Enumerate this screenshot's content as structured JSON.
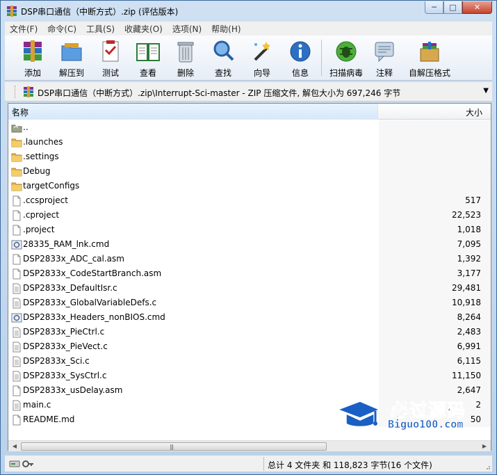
{
  "window": {
    "title": "DSP串口通信（中断方式）.zip (评估版本)",
    "controls": {
      "minimize": "─",
      "maximize": "□",
      "close": "✕"
    }
  },
  "menu": [
    "文件(F)",
    "命令(C)",
    "工具(S)",
    "收藏夹(O)",
    "选项(N)",
    "帮助(H)"
  ],
  "toolbar": [
    {
      "label": "添加",
      "icon": "add-archive-icon"
    },
    {
      "label": "解压到",
      "icon": "extract-to-icon"
    },
    {
      "label": "测试",
      "icon": "test-icon"
    },
    {
      "label": "查看",
      "icon": "view-book-icon"
    },
    {
      "label": "删除",
      "icon": "delete-trash-icon"
    },
    {
      "label": "查找",
      "icon": "find-magnifier-icon"
    },
    {
      "label": "向导",
      "icon": "wizard-wand-icon"
    },
    {
      "label": "信息",
      "icon": "info-icon"
    },
    {
      "label": "扫描病毒",
      "icon": "virus-scan-icon"
    },
    {
      "label": "注释",
      "icon": "comment-icon"
    },
    {
      "label": "自解压格式",
      "icon": "sfx-box-icon"
    }
  ],
  "address": {
    "path": "DSP串口通信（中断方式）.zip\\Interrupt-Sci-master - ZIP 压缩文件, 解包大小为 697,246 字节"
  },
  "columns": {
    "name": "名称",
    "size": "大小"
  },
  "files": [
    {
      "name": "..",
      "size": "",
      "type": "parent"
    },
    {
      "name": ".launches",
      "size": "",
      "type": "folder"
    },
    {
      "name": ".settings",
      "size": "",
      "type": "folder"
    },
    {
      "name": "Debug",
      "size": "",
      "type": "folder"
    },
    {
      "name": "targetConfigs",
      "size": "",
      "type": "folder"
    },
    {
      "name": ".ccsproject",
      "size": "517",
      "type": "file"
    },
    {
      "name": ".cproject",
      "size": "22,523",
      "type": "file"
    },
    {
      "name": ".project",
      "size": "1,018",
      "type": "file"
    },
    {
      "name": "28335_RAM_lnk.cmd",
      "size": "7,095",
      "type": "cmd"
    },
    {
      "name": "DSP2833x_ADC_cal.asm",
      "size": "1,392",
      "type": "file"
    },
    {
      "name": "DSP2833x_CodeStartBranch.asm",
      "size": "3,177",
      "type": "file"
    },
    {
      "name": "DSP2833x_DefaultIsr.c",
      "size": "29,481",
      "type": "text"
    },
    {
      "name": "DSP2833x_GlobalVariableDefs.c",
      "size": "10,918",
      "type": "text"
    },
    {
      "name": "DSP2833x_Headers_nonBIOS.cmd",
      "size": "8,264",
      "type": "cmd"
    },
    {
      "name": "DSP2833x_PieCtrl.c",
      "size": "2,483",
      "type": "text"
    },
    {
      "name": "DSP2833x_PieVect.c",
      "size": "6,991",
      "type": "text"
    },
    {
      "name": "DSP2833x_Sci.c",
      "size": "6,115",
      "type": "text"
    },
    {
      "name": "DSP2833x_SysCtrl.c",
      "size": "11,150",
      "type": "text"
    },
    {
      "name": "DSP2833x_usDelay.asm",
      "size": "2,647",
      "type": "file"
    },
    {
      "name": "main.c",
      "size": "2",
      "type": "text"
    },
    {
      "name": "README.md",
      "size": "50",
      "type": "file"
    }
  ],
  "status": {
    "summary": "总计 4 文件夹 和 118,823 字节(16 个文件)"
  },
  "watermark": {
    "cn": "必过源码",
    "en": "Biguo100.com"
  },
  "colors": {
    "accent": "#1a5fc4",
    "folder": "#e8b84a",
    "titlebar": "#cfe0f2"
  }
}
